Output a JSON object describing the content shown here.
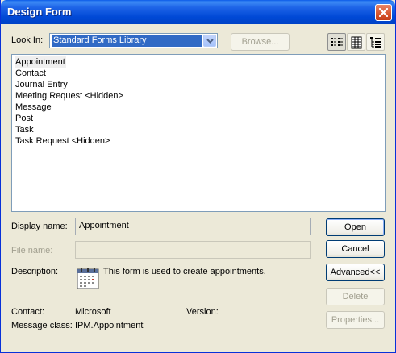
{
  "window": {
    "title": "Design Form"
  },
  "lookin": {
    "label": "Look In:",
    "selected": "Standard Forms Library",
    "browse_label": "Browse..."
  },
  "view_buttons": [
    {
      "name": "list-view",
      "active": true
    },
    {
      "name": "details-view",
      "active": false
    },
    {
      "name": "properties-view",
      "active": false
    }
  ],
  "forms": [
    "Appointment",
    "Contact",
    "Journal Entry",
    "Meeting Request <Hidden>",
    "Message",
    "Post",
    "Task",
    "Task Request <Hidden>"
  ],
  "selected_form_index": 0,
  "details": {
    "display_name_label": "Display name:",
    "display_name_value": "Appointment",
    "file_name_label": "File name:",
    "file_name_value": "",
    "description_label": "Description:",
    "description_value": "This form is used to create appointments.",
    "contact_label": "Contact:",
    "contact_value": "Microsoft",
    "version_label": "Version:",
    "version_value": "",
    "message_class_label": "Message class:",
    "message_class_value": "IPM.Appointment"
  },
  "buttons": {
    "open": "Open",
    "cancel": "Cancel",
    "advanced": "Advanced<<",
    "delete": "Delete",
    "properties": "Properties..."
  },
  "colors": {
    "titlebar": "#0054e3",
    "dialog_bg": "#ece9d8",
    "selection": "#316ac5",
    "close_button": "#d6542c"
  }
}
